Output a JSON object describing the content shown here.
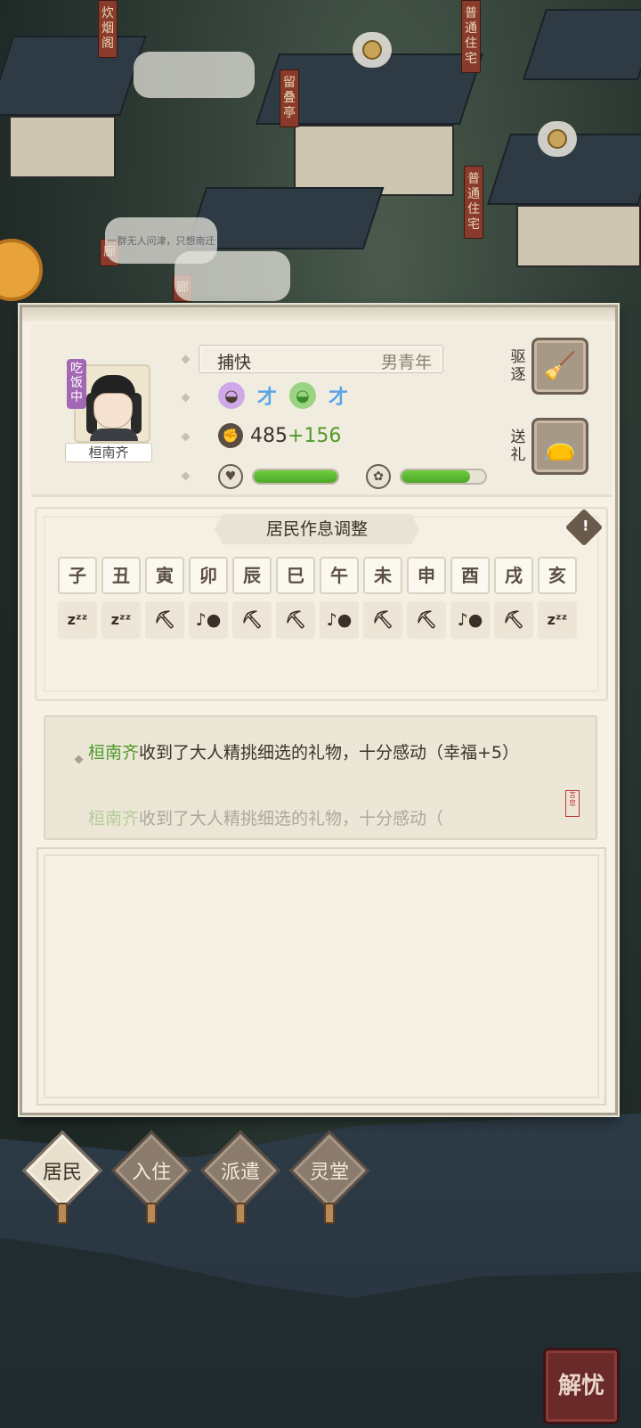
{
  "map": {
    "labels": [
      "普通住宅",
      "普通住宅",
      "留叠亭",
      "炊烟阁",
      "廊",
      "廊"
    ],
    "speech": [
      "",
      "一群无人问津，只想南迁",
      ""
    ]
  },
  "resident": {
    "status_badge": "吃饭中",
    "name": "桓南齐",
    "job": "捕快",
    "demographic": "男青年",
    "talents": [
      {
        "icon": "purple-talent-icon",
        "text": "才",
        "color": "#b07ad0"
      },
      {
        "icon": "green-talent-icon",
        "text": "才",
        "color": "#4fb83a"
      }
    ],
    "power_value": "485",
    "power_bonus": "+156",
    "health_level": 1.0,
    "happiness_level": 0.82,
    "actions": {
      "evict_label": "驱逐",
      "gift_label": "送礼"
    }
  },
  "schedule": {
    "title": "居民作息调整",
    "hours": [
      "子",
      "丑",
      "寅",
      "卯",
      "辰",
      "巳",
      "午",
      "未",
      "申",
      "酉",
      "戌",
      "亥"
    ],
    "activities": [
      "sleep",
      "sleep",
      "work",
      "leisure",
      "work",
      "work",
      "leisure",
      "work",
      "work",
      "leisure",
      "work",
      "sleep"
    ],
    "activity_glyphs": {
      "sleep": "zᶻᶻ",
      "work": "⛏",
      "leisure": "♪●"
    }
  },
  "log": {
    "entries": [
      {
        "who": "桓南齐",
        "text": "收到了大人精挑细选的礼物，十分感动（幸福+5）"
      },
      {
        "who": "桓南齐",
        "text": "收到了大人精挑细选的礼物，十分感动（"
      }
    ]
  },
  "tabs": [
    "居民",
    "入住",
    "派遣",
    "灵堂"
  ],
  "corner_button": "解忧"
}
